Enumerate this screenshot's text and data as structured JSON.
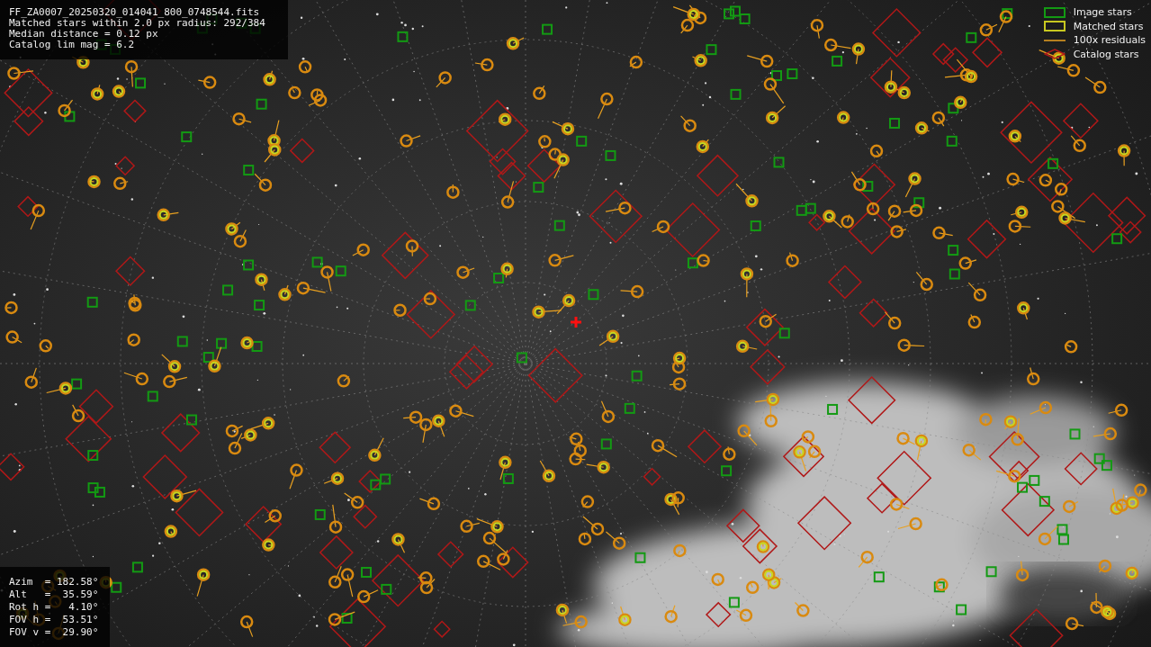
{
  "info": {
    "lines": [
      "FF_ZA0007_20250320_014041_800_0748544.fits",
      "Matched stars within 2.0 px radius: 292/384",
      "Median distance = 0.12 px",
      "Catalog lim mag = 6.2"
    ]
  },
  "legend": [
    {
      "label": "Image stars"
    },
    {
      "kind": "matched",
      "label": "Matched stars"
    },
    {
      "kind": "residual",
      "label": "100x residuals"
    },
    {
      "kind": "catalog",
      "label": "Catalog stars"
    }
  ],
  "pointing": {
    "lines": [
      "Azim  = 182.58°",
      "Alt   =  35.59°",
      "Rot h =   4.10°",
      "FOV h =  53.51°",
      "FOV v =  29.90°"
    ]
  }
}
